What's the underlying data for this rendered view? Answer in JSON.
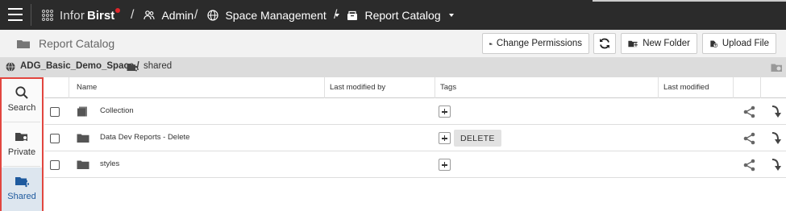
{
  "topbar": {
    "brand_part1": "Infor",
    "brand_part2": "Birst",
    "crumbs": [
      {
        "icon": "users-icon",
        "label": "Admin"
      },
      {
        "icon": "globe-icon",
        "label": "Space Management"
      },
      {
        "icon": "catalog-icon",
        "label": "Report Catalog"
      }
    ],
    "menu_icon": "hamburger-icon"
  },
  "subheader": {
    "title": "Report Catalog",
    "buttons": {
      "change_permissions": "Change Permissions",
      "refresh_icon": "refresh-icon",
      "new_folder": "New Folder",
      "upload_file": "Upload File"
    }
  },
  "path": {
    "space": "ADG_Basic_Demo_Space /",
    "folder": "shared"
  },
  "rail": {
    "items": [
      {
        "label": "Search",
        "icon": "search-icon",
        "active": false
      },
      {
        "label": "Private",
        "icon": "private-folder-icon",
        "active": false
      },
      {
        "label": "Shared",
        "icon": "shared-folder-icon",
        "active": true
      }
    ]
  },
  "table": {
    "columns": [
      "Name",
      "Last modified by",
      "Tags",
      "Last modified"
    ],
    "rows": [
      {
        "name": "Collection",
        "type": "collection",
        "tags": []
      },
      {
        "name": "Data Dev Reports - Delete",
        "type": "folder",
        "tags": [
          "DELETE"
        ]
      },
      {
        "name": "styles",
        "type": "folder",
        "tags": []
      }
    ]
  },
  "colors": {
    "topbar_bg": "#2b2b2b",
    "rail_highlight": "#e2463f",
    "active_blue": "#1e5a9e"
  }
}
